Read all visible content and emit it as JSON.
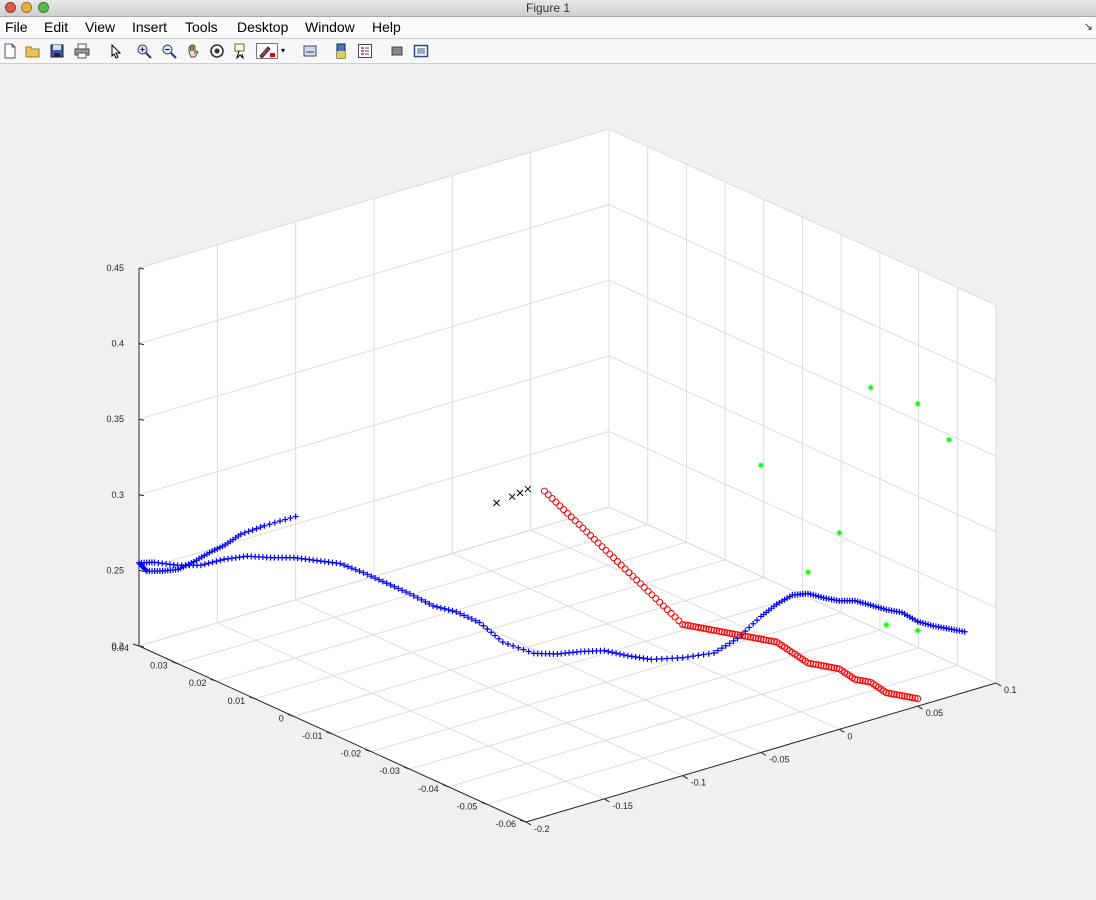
{
  "window": {
    "title": "Figure 1"
  },
  "menu": [
    {
      "label": "File"
    },
    {
      "label": "Edit"
    },
    {
      "label": "View"
    },
    {
      "label": "Insert"
    },
    {
      "label": "Tools"
    },
    {
      "label": "Desktop"
    },
    {
      "label": "Window"
    },
    {
      "label": "Help"
    }
  ],
  "toolbar": [
    {
      "icon": "new-figure-icon"
    },
    {
      "icon": "open-file-icon"
    },
    {
      "icon": "save-icon"
    },
    {
      "icon": "print-icon"
    },
    {
      "icon": "edit-plot-pointer-icon"
    },
    {
      "icon": "zoom-in-icon"
    },
    {
      "icon": "zoom-out-icon"
    },
    {
      "icon": "pan-hand-icon"
    },
    {
      "icon": "rotate-3d-icon"
    },
    {
      "icon": "data-cursor-icon"
    },
    {
      "icon": "brush-icon"
    },
    {
      "icon": "link-plot-icon"
    },
    {
      "icon": "insert-colorbar-icon"
    },
    {
      "icon": "insert-legend-icon"
    },
    {
      "icon": "hide-plot-tools-icon"
    },
    {
      "icon": "show-plot-tools-icon"
    }
  ],
  "colors": {
    "blue_series": "#0000ff",
    "red_series": "#ff0000",
    "green_series": "#00ff00",
    "black_series": "#000000",
    "grid": "#dcdcdc",
    "axes_bg": "#ffffff"
  },
  "chart_data": {
    "type": "scatter",
    "title": "",
    "xlim": [
      -0.2,
      0.1
    ],
    "ylim": [
      -0.06,
      0.04
    ],
    "zlim": [
      0.2,
      0.45
    ],
    "x_ticks": [
      "-0.2",
      "-0.15",
      "-0.1",
      "-0.05",
      "0",
      "0.05",
      "0.1"
    ],
    "y_ticks": [
      "-0.06",
      "-0.05",
      "-0.04",
      "-0.03",
      "-0.02",
      "-0.01",
      "0",
      "0.01",
      "0.02",
      "0.03",
      "0.04"
    ],
    "z_ticks": [
      "0.2",
      "0.25",
      "0.3",
      "0.35",
      "0.4",
      "0.45"
    ],
    "grid": true,
    "series": [
      {
        "marker": "+",
        "color": "#0000ff",
        "points": [
          [
            -0.1,
            0.04,
            0.255
          ],
          [
            -0.12,
            0.04,
            0.255
          ],
          [
            -0.135,
            0.04,
            0.254
          ],
          [
            -0.145,
            0.04,
            0.25
          ],
          [
            -0.155,
            0.04,
            0.248
          ],
          [
            -0.165,
            0.04,
            0.245
          ],
          [
            -0.175,
            0.04,
            0.243
          ],
          [
            -0.185,
            0.04,
            0.245
          ],
          [
            -0.195,
            0.04,
            0.248
          ],
          [
            -0.2,
            0.04,
            0.255
          ],
          [
            -0.2,
            0.036,
            0.26
          ],
          [
            -0.2,
            0.03,
            0.265
          ],
          [
            -0.2,
            0.024,
            0.272
          ],
          [
            -0.2,
            0.018,
            0.283
          ],
          [
            -0.2,
            0.012,
            0.292
          ],
          [
            -0.2,
            0.006,
            0.298
          ],
          [
            -0.2,
            0.0,
            0.305
          ],
          [
            -0.2,
            -0.006,
            0.31
          ],
          [
            -0.2,
            -0.012,
            0.315
          ],
          [
            -0.2,
            -0.018,
            0.316
          ],
          [
            -0.2,
            -0.024,
            0.316
          ],
          [
            -0.2,
            -0.03,
            0.316
          ],
          [
            -0.2,
            -0.036,
            0.315
          ],
          [
            -0.2,
            -0.042,
            0.318
          ],
          [
            -0.2,
            -0.048,
            0.318
          ],
          [
            -0.2,
            -0.054,
            0.312
          ],
          [
            -0.195,
            -0.06,
            0.31
          ],
          [
            -0.18,
            -0.06,
            0.305
          ],
          [
            -0.165,
            -0.06,
            0.302
          ],
          [
            -0.15,
            -0.06,
            0.298
          ],
          [
            -0.135,
            -0.06,
            0.29
          ],
          [
            -0.12,
            -0.06,
            0.283
          ],
          [
            -0.1,
            -0.06,
            0.278
          ],
          [
            -0.08,
            -0.06,
            0.275
          ],
          [
            -0.065,
            -0.06,
            0.28
          ],
          [
            -0.05,
            -0.06,
            0.29
          ],
          [
            -0.04,
            -0.06,
            0.295
          ],
          [
            -0.03,
            -0.06,
            0.298
          ],
          [
            -0.02,
            -0.06,
            0.296
          ],
          [
            -0.01,
            -0.06,
            0.29
          ],
          [
            0.0,
            -0.06,
            0.285
          ],
          [
            0.01,
            -0.06,
            0.282
          ],
          [
            0.02,
            -0.06,
            0.276
          ],
          [
            0.03,
            -0.06,
            0.27
          ],
          [
            0.04,
            -0.06,
            0.265
          ],
          [
            0.05,
            -0.06,
            0.256
          ],
          [
            0.06,
            -0.06,
            0.25
          ],
          [
            0.07,
            -0.06,
            0.245
          ],
          [
            0.08,
            -0.06,
            0.24
          ]
        ]
      },
      {
        "marker": "o",
        "color": "#ff0000",
        "points": [
          [
            -0.04,
            0.0,
            0.3
          ],
          [
            -0.05,
            -0.01,
            0.3
          ],
          [
            -0.06,
            -0.02,
            0.3
          ],
          [
            -0.07,
            -0.03,
            0.3
          ],
          [
            -0.08,
            -0.04,
            0.3
          ],
          [
            -0.09,
            -0.05,
            0.3
          ],
          [
            -0.1,
            -0.06,
            0.3
          ],
          [
            -0.09,
            -0.06,
            0.295
          ],
          [
            -0.08,
            -0.06,
            0.29
          ],
          [
            -0.07,
            -0.06,
            0.285
          ],
          [
            -0.06,
            -0.06,
            0.28
          ],
          [
            -0.05,
            -0.06,
            0.275
          ],
          [
            -0.04,
            -0.06,
            0.27
          ],
          [
            -0.03,
            -0.06,
            0.26
          ],
          [
            -0.02,
            -0.06,
            0.25
          ],
          [
            -0.01,
            -0.06,
            0.245
          ],
          [
            0.0,
            -0.06,
            0.24
          ],
          [
            0.01,
            -0.06,
            0.23
          ],
          [
            0.02,
            -0.06,
            0.225
          ],
          [
            0.03,
            -0.06,
            0.215
          ],
          [
            0.04,
            -0.06,
            0.21
          ],
          [
            0.05,
            -0.06,
            0.205
          ]
        ]
      },
      {
        "marker": "*",
        "color": "#00ff00",
        "points": [
          [
            -0.05,
            -0.06,
            0.39
          ],
          [
            0.02,
            -0.06,
            0.42
          ],
          [
            0.05,
            -0.06,
            0.4
          ],
          [
            0.07,
            -0.06,
            0.37
          ],
          [
            0.0,
            -0.06,
            0.33
          ],
          [
            -0.02,
            -0.06,
            0.31
          ],
          [
            0.03,
            -0.06,
            0.26
          ],
          [
            0.05,
            -0.06,
            0.25
          ]
        ]
      },
      {
        "marker": "x",
        "color": "#000000",
        "points": [
          [
            -0.12,
            -0.02,
            0.34
          ],
          [
            -0.11,
            -0.02,
            0.341
          ],
          [
            -0.105,
            -0.02,
            0.342
          ],
          [
            -0.1,
            -0.02,
            0.343
          ]
        ]
      }
    ]
  }
}
